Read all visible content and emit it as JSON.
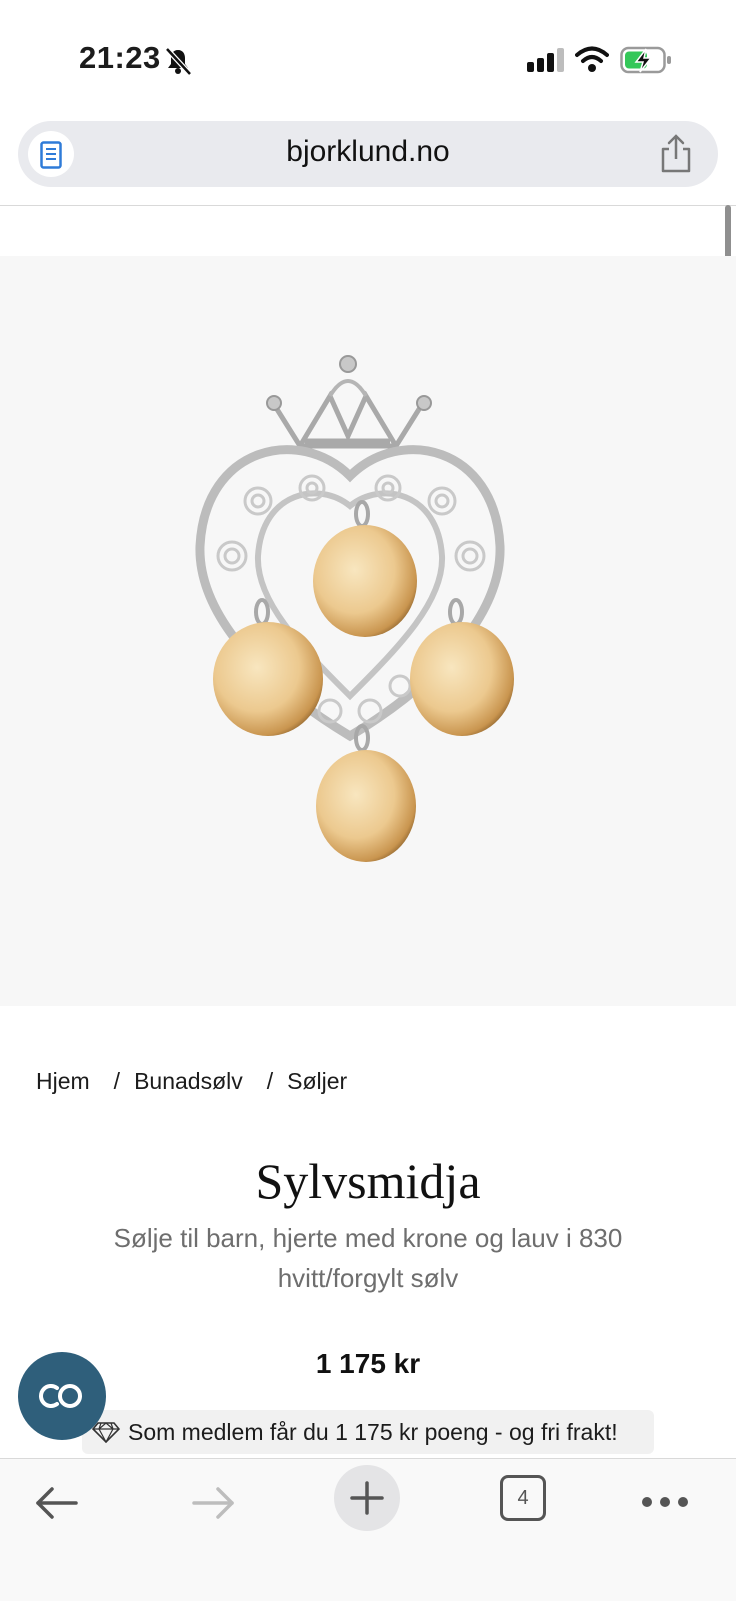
{
  "status": {
    "time": "21:23"
  },
  "browser": {
    "url": "bjorklund.no",
    "tab_count": "4"
  },
  "breadcrumb": [
    "Hjem",
    "Bunadsølv",
    "Søljer"
  ],
  "product": {
    "brand": "Sylvsmidja",
    "name": "Sølje til barn, hjerte med krone og lauv i 830 hvitt/forgylt sølv",
    "price": "1 175 kr",
    "member_text": "Som medlem får du 1 175 kr poeng - og fri frakt!"
  },
  "chat": {
    "label": "CO"
  },
  "colors": {
    "chat_button": "#2f5f7b",
    "url_bar": "#e9eaee",
    "reader_icon": "#2f7bd8",
    "battery_charge": "#34c759"
  },
  "icons": [
    "bell-slash-icon",
    "signal-icon",
    "wifi-icon",
    "battery-charging-icon",
    "reader-icon",
    "share-icon",
    "back-arrow-icon",
    "forward-arrow-icon",
    "plus-icon",
    "tabs-icon",
    "more-icon",
    "diamond-icon"
  ]
}
